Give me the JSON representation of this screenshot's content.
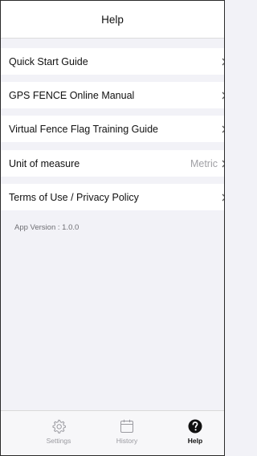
{
  "header": {
    "title": "Help"
  },
  "menu": [
    {
      "label": "Quick Start Guide",
      "value": ""
    },
    {
      "label": "GPS FENCE Online Manual",
      "value": ""
    },
    {
      "label": "Virtual Fence Flag Training Guide",
      "value": ""
    },
    {
      "label": "Unit of measure",
      "value": "Metric"
    },
    {
      "label": "Terms of Use / Privacy Policy",
      "value": ""
    }
  ],
  "app_version": "App Version : 1.0.0",
  "tabbar": {
    "tabs": [
      {
        "label": "Settings",
        "icon": "gear-icon",
        "active": false
      },
      {
        "label": "History",
        "icon": "calendar-icon",
        "active": false
      },
      {
        "label": "Help",
        "icon": "question-icon",
        "active": true
      }
    ]
  },
  "colors": {
    "background": "#f2f2f7",
    "row": "#ffffff",
    "inactive": "#9a9aa0",
    "active": "#111111"
  }
}
